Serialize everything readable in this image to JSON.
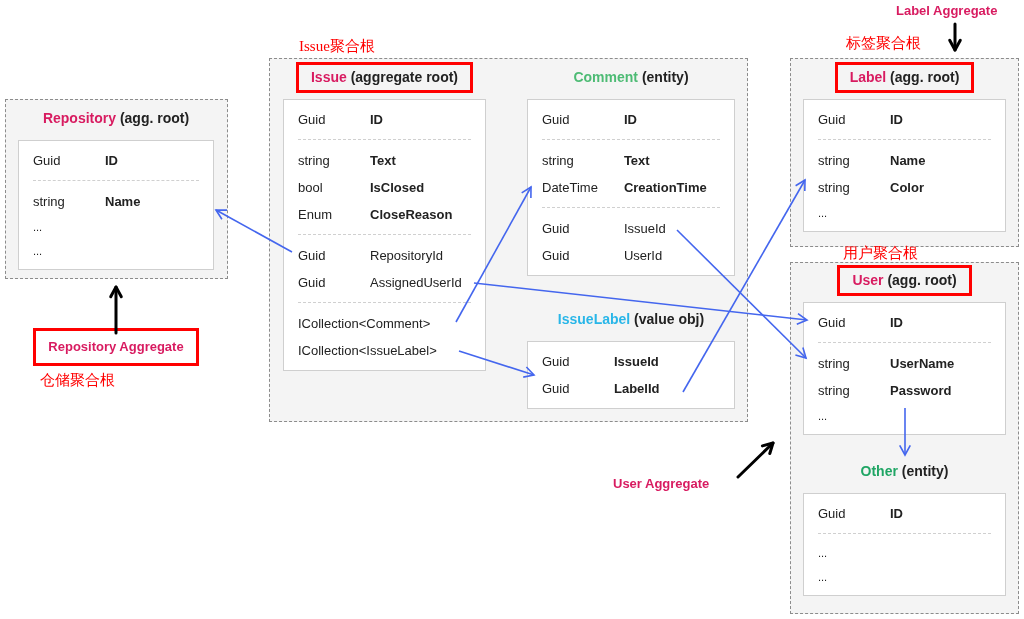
{
  "aggregates": [
    {
      "caption": "仓储聚合根",
      "tag": {
        "text": "Repository Aggregate",
        "boxed": true
      },
      "entities": [
        {
          "name": "Repository",
          "role": "(agg. root)",
          "color": "#d81b60",
          "highlighted": false,
          "sections": [
            [
              {
                "kind": "field",
                "type": "Guid",
                "name": "ID",
                "bold": true
              }
            ],
            [
              {
                "kind": "field",
                "type": "string",
                "name": "Name",
                "bold": true
              },
              {
                "kind": "more",
                "text": "..."
              },
              {
                "kind": "more",
                "text": "..."
              }
            ]
          ]
        }
      ]
    },
    {
      "caption": "Issue聚合根",
      "entities": [
        {
          "name": "Issue",
          "role": "(aggregate root)",
          "color": "#d81b60",
          "highlighted": true,
          "sections": [
            [
              {
                "kind": "field",
                "type": "Guid",
                "name": "ID",
                "bold": true
              }
            ],
            [
              {
                "kind": "field",
                "type": "string",
                "name": "Text",
                "bold": true
              },
              {
                "kind": "field",
                "type": "bool",
                "name": "IsClosed",
                "bold": true
              },
              {
                "kind": "field",
                "type": "Enum",
                "name": "CloseReason",
                "bold": true
              }
            ],
            [
              {
                "kind": "field",
                "type": "Guid",
                "name": "RepositoryId",
                "bold": false
              },
              {
                "kind": "field",
                "type": "Guid",
                "name": "AssignedUserId",
                "bold": false
              }
            ],
            [
              {
                "kind": "collection",
                "type": "ICollection<Comment>"
              },
              {
                "kind": "collection",
                "type": "ICollection<IssueLabel>"
              }
            ]
          ]
        },
        {
          "name": "Comment",
          "role": "(entity)",
          "color": "#4dbb74",
          "highlighted": false,
          "sections": [
            [
              {
                "kind": "field",
                "type": "Guid",
                "name": "ID",
                "bold": true
              }
            ],
            [
              {
                "kind": "field",
                "type": "string",
                "name": "Text",
                "bold": true
              },
              {
                "kind": "field",
                "type": "DateTime",
                "name": "CreationTime",
                "bold": true
              }
            ],
            [
              {
                "kind": "field",
                "type": "Guid",
                "name": "IssueId",
                "bold": false
              },
              {
                "kind": "field",
                "type": "Guid",
                "name": "UserId",
                "bold": false
              }
            ]
          ]
        },
        {
          "name": "IssueLabel",
          "role": "(value obj)",
          "color": "#29b6e8",
          "highlighted": false,
          "sections": [
            [
              {
                "kind": "field",
                "type": "Guid",
                "name": "IssueId",
                "bold": true
              },
              {
                "kind": "field",
                "type": "Guid",
                "name": "LabelId",
                "bold": true
              }
            ]
          ]
        }
      ]
    },
    {
      "caption": "标签聚合根",
      "tag": {
        "text": "Label Aggregate",
        "boxed": false
      },
      "entities": [
        {
          "name": "Label",
          "role": "(agg. root)",
          "color": "#d81b60",
          "highlighted": true,
          "sections": [
            [
              {
                "kind": "field",
                "type": "Guid",
                "name": "ID",
                "bold": true
              }
            ],
            [
              {
                "kind": "field",
                "type": "string",
                "name": "Name",
                "bold": true
              },
              {
                "kind": "field",
                "type": "string",
                "name": "Color",
                "bold": true
              },
              {
                "kind": "more",
                "text": "..."
              }
            ]
          ]
        }
      ]
    },
    {
      "caption": "用户聚合根",
      "tag": {
        "text": "User Aggregate",
        "boxed": false
      },
      "entities": [
        {
          "name": "User",
          "role": "(agg. root)",
          "color": "#d81b60",
          "highlighted": true,
          "sections": [
            [
              {
                "kind": "field",
                "type": "Guid",
                "name": "ID",
                "bold": true
              }
            ],
            [
              {
                "kind": "field",
                "type": "string",
                "name": "UserName",
                "bold": true
              },
              {
                "kind": "field",
                "type": "string",
                "name": "Password",
                "bold": true
              },
              {
                "kind": "more",
                "text": "..."
              }
            ]
          ]
        },
        {
          "name": "Other",
          "role": "(entity)",
          "color": "#1fa564",
          "highlighted": false,
          "sections": [
            [
              {
                "kind": "field",
                "type": "Guid",
                "name": "ID",
                "bold": true
              }
            ],
            [
              {
                "kind": "more",
                "text": "..."
              },
              {
                "kind": "more",
                "text": "..."
              }
            ]
          ]
        }
      ]
    }
  ]
}
